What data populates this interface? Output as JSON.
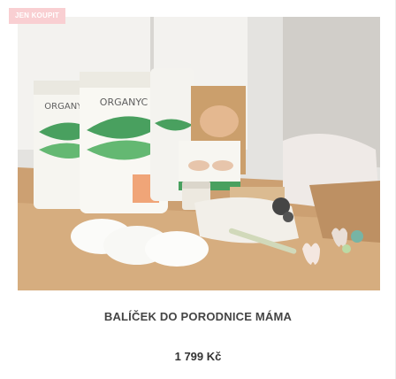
{
  "product": {
    "badge": "JEN KOUPIT",
    "name": "BALÍČEK DO PORODNICE MÁMA",
    "price": "1 799 Kč",
    "image_icon": "product-photo-bundle",
    "package_brand": "ORGANYC"
  },
  "colors": {
    "badge_bg": "#f9cfd2",
    "title_text": "#444444",
    "price_text": "#333333",
    "package_green": "#3e9b55"
  }
}
